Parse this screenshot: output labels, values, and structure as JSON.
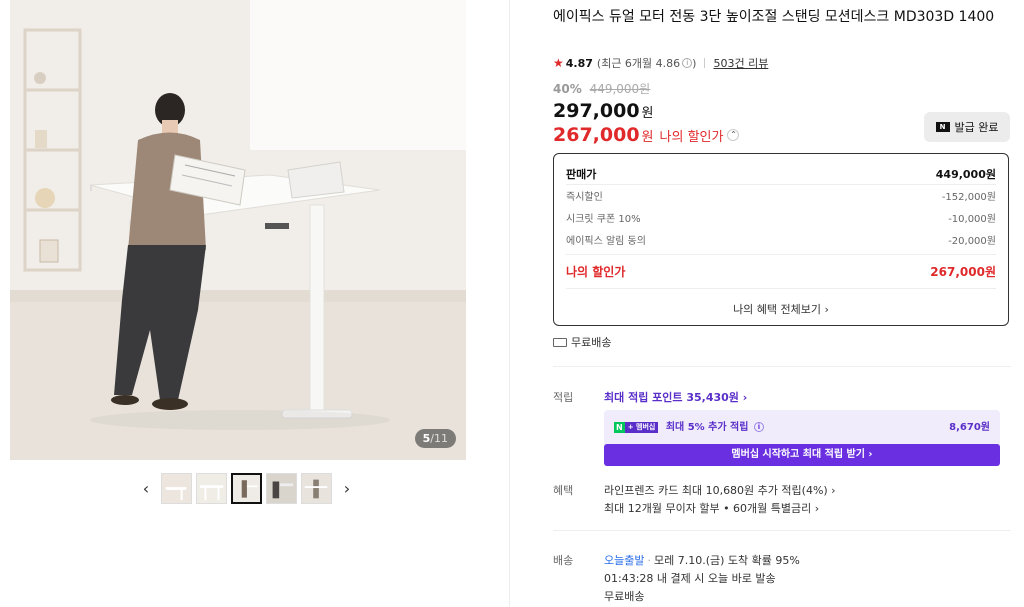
{
  "gallery": {
    "counter_current": "5",
    "counter_total": "/11",
    "prev_arrow": "‹",
    "next_arrow": "›",
    "thumb_count": 5,
    "active_thumb": 3
  },
  "product": {
    "title": "에이픽스 듀얼 모터 전동 3단 높이조절 스탠딩 모션데스크 MD303D 1400",
    "rating_star": "★",
    "rating_score": "4.87",
    "rating_recent": "(최근 6개월 4.86",
    "rating_recent_close": ")",
    "review_count": "503건 리뷰",
    "discount_pct": "40%",
    "original_price": "449,000원",
    "price": "297,000",
    "price_unit": "원",
    "my_price": "267,000",
    "my_price_unit": "원",
    "my_price_label": "나의 할인가",
    "coupon_icon": "N",
    "coupon_label": "발급 완료"
  },
  "breakdown": {
    "rows": [
      {
        "label": "판매가",
        "value": "449,000원"
      },
      {
        "label": "즉시할인",
        "value": "-152,000원"
      },
      {
        "label": "시크릿 쿠폰 10%",
        "value": "-10,000원"
      },
      {
        "label": "에이픽스 알림 동의",
        "value": "-20,000원"
      }
    ],
    "mine_label": "나의 할인가",
    "mine_value": "267,000원",
    "view_all": "나의 혜택 전체보기 ›"
  },
  "shipping_free": "무료배송",
  "points": {
    "label": "적립",
    "link": "최대 적립 포인트 35,430원 ›",
    "badge_n": "N",
    "badge_m": "+ 멤버십",
    "extra": "최대 5% 추가 적립",
    "extra_value": "8,670원",
    "button": "멤버십 시작하고 최대 적립 받기 ›"
  },
  "benefits": {
    "label": "혜택",
    "line1": "라인프렌즈 카드 최대 10,680원 추가 적립(4%) ›",
    "line2": "최대 12개월 무이자 할부 • 60개월 특별금리 ›"
  },
  "delivery": {
    "label": "배송",
    "today": "오늘출발",
    "eta": "모레 7.10.(금) 도착 확률 95%",
    "deadline": "01:43:28  내 결제 시 오늘 바로 발송",
    "fee": "무료배송"
  },
  "colors": {
    "accent_red": "#e0292b",
    "membership_purple": "#6a2fe0",
    "naver_green": "#03c75a",
    "link_blue": "#2a6ee8"
  }
}
